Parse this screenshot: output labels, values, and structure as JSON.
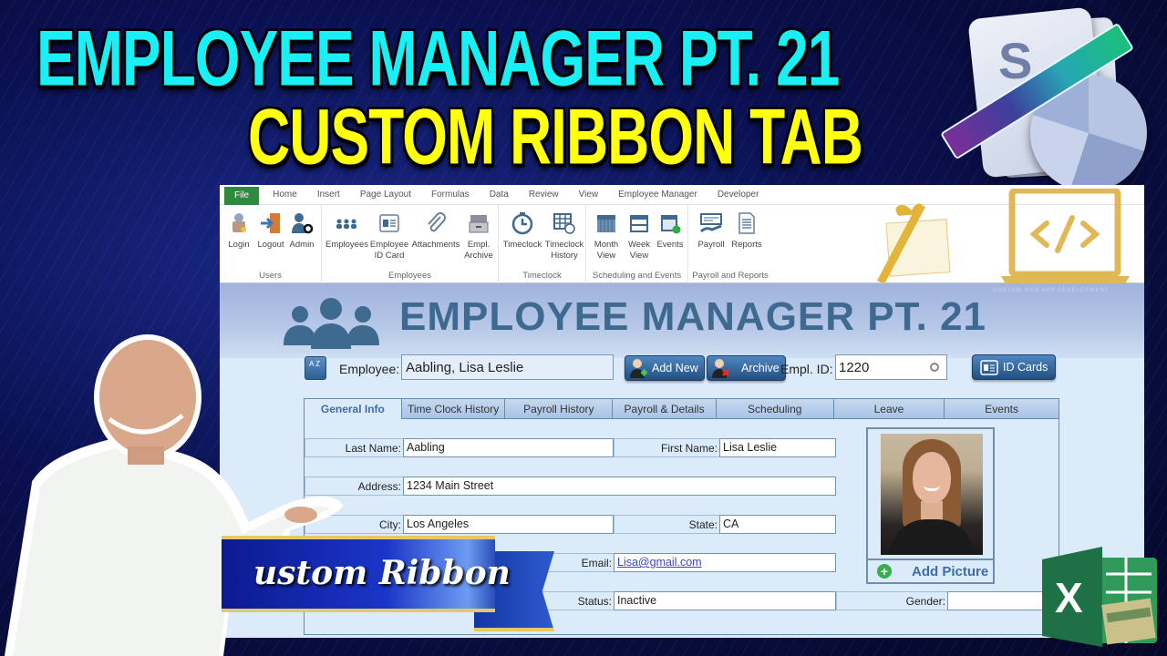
{
  "thumbnail": {
    "title_line1": "EMPLOYEE MANAGER PT. 21",
    "title_line2": "CUSTOM RIBBON TAB",
    "banner_text": "ustom Ribbon",
    "laptop_caption": "CUSTOM WEB APP DEVELOPMENT",
    "colors": {
      "title1": "#18f0f5",
      "title2": "#ffff10",
      "excel_green": "#1e7145"
    }
  },
  "excel": {
    "tabs": [
      "File",
      "Home",
      "Insert",
      "Page Layout",
      "Formulas",
      "Data",
      "Review",
      "View",
      "Employee Manager",
      "Developer"
    ],
    "active_tab": "Employee Manager",
    "ribbon_groups": [
      {
        "label": "Users",
        "buttons": [
          {
            "label": "Login",
            "icon": "lock-user-icon"
          },
          {
            "label": "Logout",
            "icon": "door-exit-icon"
          },
          {
            "label": "Admin",
            "icon": "admin-gear-icon"
          }
        ]
      },
      {
        "label": "Employees",
        "buttons": [
          {
            "label": "Employees",
            "icon": "people-group-icon"
          },
          {
            "label": "Employee ID Card",
            "icon": "id-card-icon"
          },
          {
            "label": "Attachments",
            "icon": "paperclip-icon"
          },
          {
            "label": "Empl. Archive",
            "icon": "archive-drawer-icon"
          }
        ]
      },
      {
        "label": "Timeclock",
        "buttons": [
          {
            "label": "Timeclock",
            "icon": "clock-icon"
          },
          {
            "label": "Timeclock History",
            "icon": "table-clock-icon"
          }
        ]
      },
      {
        "label": "Scheduling and Events",
        "buttons": [
          {
            "label": "Month View",
            "icon": "calendar-month-icon"
          },
          {
            "label": "Week View",
            "icon": "calendar-week-icon"
          },
          {
            "label": "Events",
            "icon": "calendar-check-icon"
          }
        ]
      },
      {
        "label": "Payroll and Reports",
        "buttons": [
          {
            "label": "Payroll",
            "icon": "payroll-check-icon"
          },
          {
            "label": "Reports",
            "icon": "report-document-icon"
          }
        ]
      }
    ]
  },
  "app": {
    "title": "EMPLOYEE MANAGER PT. 21",
    "employee_label": "Employee:",
    "employee_value": "Aabling, Lisa Leslie",
    "add_new_label": "Add New",
    "archive_label": "Archive",
    "empl_id_label": "Empl. ID:",
    "empl_id_value": "1220",
    "id_cards_label": "ID Cards",
    "sort_label": "A Z",
    "form_tabs": [
      "General Info",
      "Time Clock History",
      "Payroll History",
      "Payroll & Details",
      "Scheduling",
      "Leave",
      "Events"
    ],
    "active_form_tab": "General Info",
    "fields": {
      "last_name": {
        "label": "Last Name:",
        "value": "Aabling"
      },
      "first_name": {
        "label": "First Name:",
        "value": "Lisa Leslie"
      },
      "address": {
        "label": "Address:",
        "value": "1234 Main Street"
      },
      "city": {
        "label": "City:",
        "value": "Los Angeles"
      },
      "state": {
        "label": "State:",
        "value": "CA"
      },
      "email": {
        "label": "Email:",
        "value": "Lisa@gmail.com"
      },
      "status": {
        "label": "Status:",
        "value": "Inactive"
      },
      "gender": {
        "label": "Gender:",
        "value": ""
      }
    },
    "add_picture_label": "Add Picture",
    "colors": {
      "accent": "#3f6a90",
      "panel": "#dcebfa",
      "file_tab": "#2e8b3e"
    }
  }
}
